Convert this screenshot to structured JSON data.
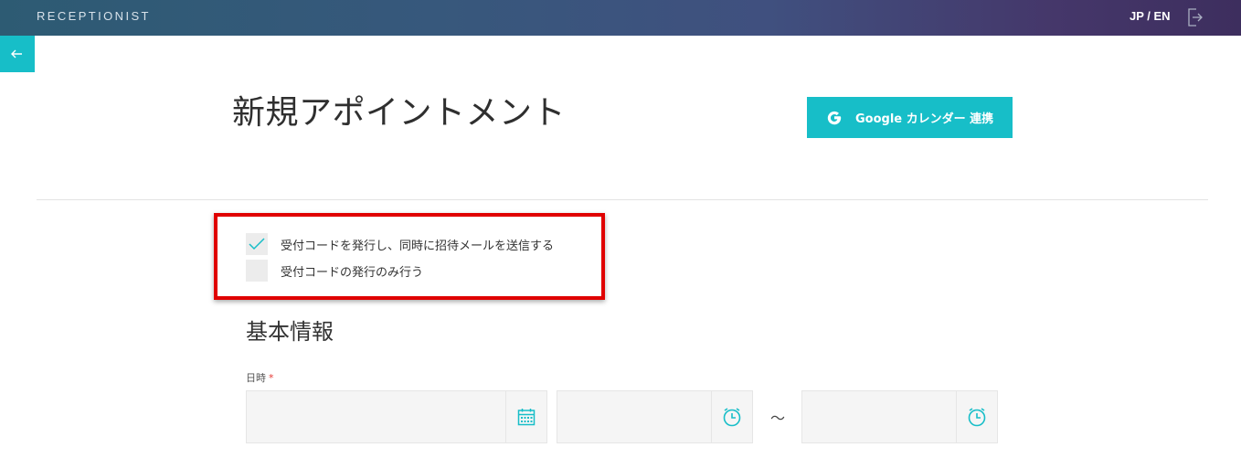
{
  "header": {
    "brand": "RECEPTIONIST",
    "language_toggle": "JP / EN"
  },
  "page": {
    "title": "新規アポイントメント",
    "google_calendar_button": "Google カレンダー 連携"
  },
  "issue_options": [
    {
      "label": "受付コードを発行し、同時に招待メールを送信する",
      "checked": true
    },
    {
      "label": "受付コードの発行のみ行う",
      "checked": false
    }
  ],
  "basic_info": {
    "title": "基本情報",
    "datetime_label": "日時",
    "required_mark": "*",
    "range_separator": "〜",
    "date_value": "",
    "start_time_value": "",
    "end_time_value": ""
  },
  "colors": {
    "accent": "#17bec8",
    "highlight": "#e00000",
    "header_start": "#2d5b73",
    "header_end": "#3d2e5e"
  }
}
